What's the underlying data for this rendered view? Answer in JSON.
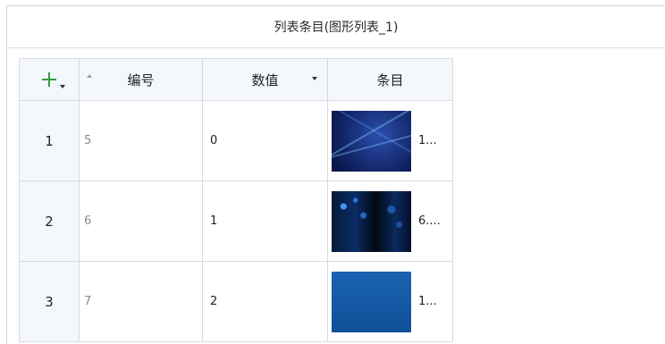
{
  "window": {
    "title": "列表条目(图形列表_1)"
  },
  "table": {
    "columns": {
      "number": "编号",
      "value": "数值",
      "item": "条目"
    },
    "rows": [
      {
        "index": "1",
        "number": "5",
        "value": "0",
        "item_label": "1..."
      },
      {
        "index": "2",
        "number": "6",
        "value": "1",
        "item_label": "6...."
      },
      {
        "index": "3",
        "number": "7",
        "value": "2",
        "item_label": "1..."
      }
    ]
  },
  "colors": {
    "accent_add": "#2e9e3c",
    "header_bg": "#f4f7fc",
    "grid_line": "#d7dbe0"
  },
  "icons": [
    "plus-icon",
    "caret-down-icon",
    "sort-up-icon",
    "dropdown-icon"
  ]
}
